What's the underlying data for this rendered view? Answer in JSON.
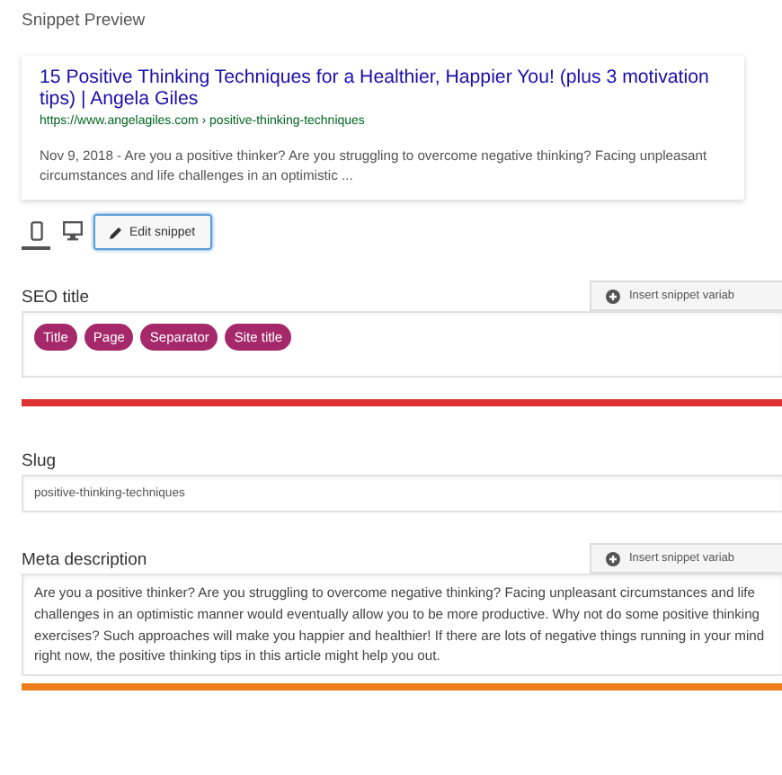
{
  "heading": "Snippet Preview",
  "snippet": {
    "title": "15 Positive Thinking Techniques for a Healthier, Happier You! (plus 3 motivation tips) | Angela Giles",
    "url": "https://www.angelagiles.com › positive-thinking-techniques",
    "description": "Nov 9, 2018 - Are you a positive thinker? Are you struggling to overcome negative thinking? Facing unpleasant circumstances and life challenges in an optimistic ..."
  },
  "preview_modes": [
    {
      "kind": "mobile",
      "selected": true
    },
    {
      "kind": "desktop",
      "selected": false
    }
  ],
  "edit_button": "Edit snippet",
  "fields": [
    {
      "kind": "tags",
      "label": "SEO title",
      "insert_button": "Insert snippet variab",
      "tags": [
        "Title",
        "Page",
        "Separator",
        "Site title"
      ],
      "progress": {
        "level": 1,
        "color": "#dc3232"
      }
    },
    {
      "kind": "text",
      "label": "Slug",
      "value": "positive-thinking-techniques"
    },
    {
      "kind": "textarea",
      "label": "Meta description",
      "insert_button": "Insert snippet variab",
      "value": "Are you a positive thinker? Are you struggling to overcome negative thinking? Facing unpleasant circumstances and life challenges in an optimistic manner would eventually allow you to be more productive. Why not do some positive thinking exercises? Such approaches will make you happier and healthier! If there are lots of negative things running in your mind right now, the positive thinking tips in this article might help you out.",
      "progress": {
        "level": 1,
        "color": "#ee7c1b"
      }
    }
  ]
}
